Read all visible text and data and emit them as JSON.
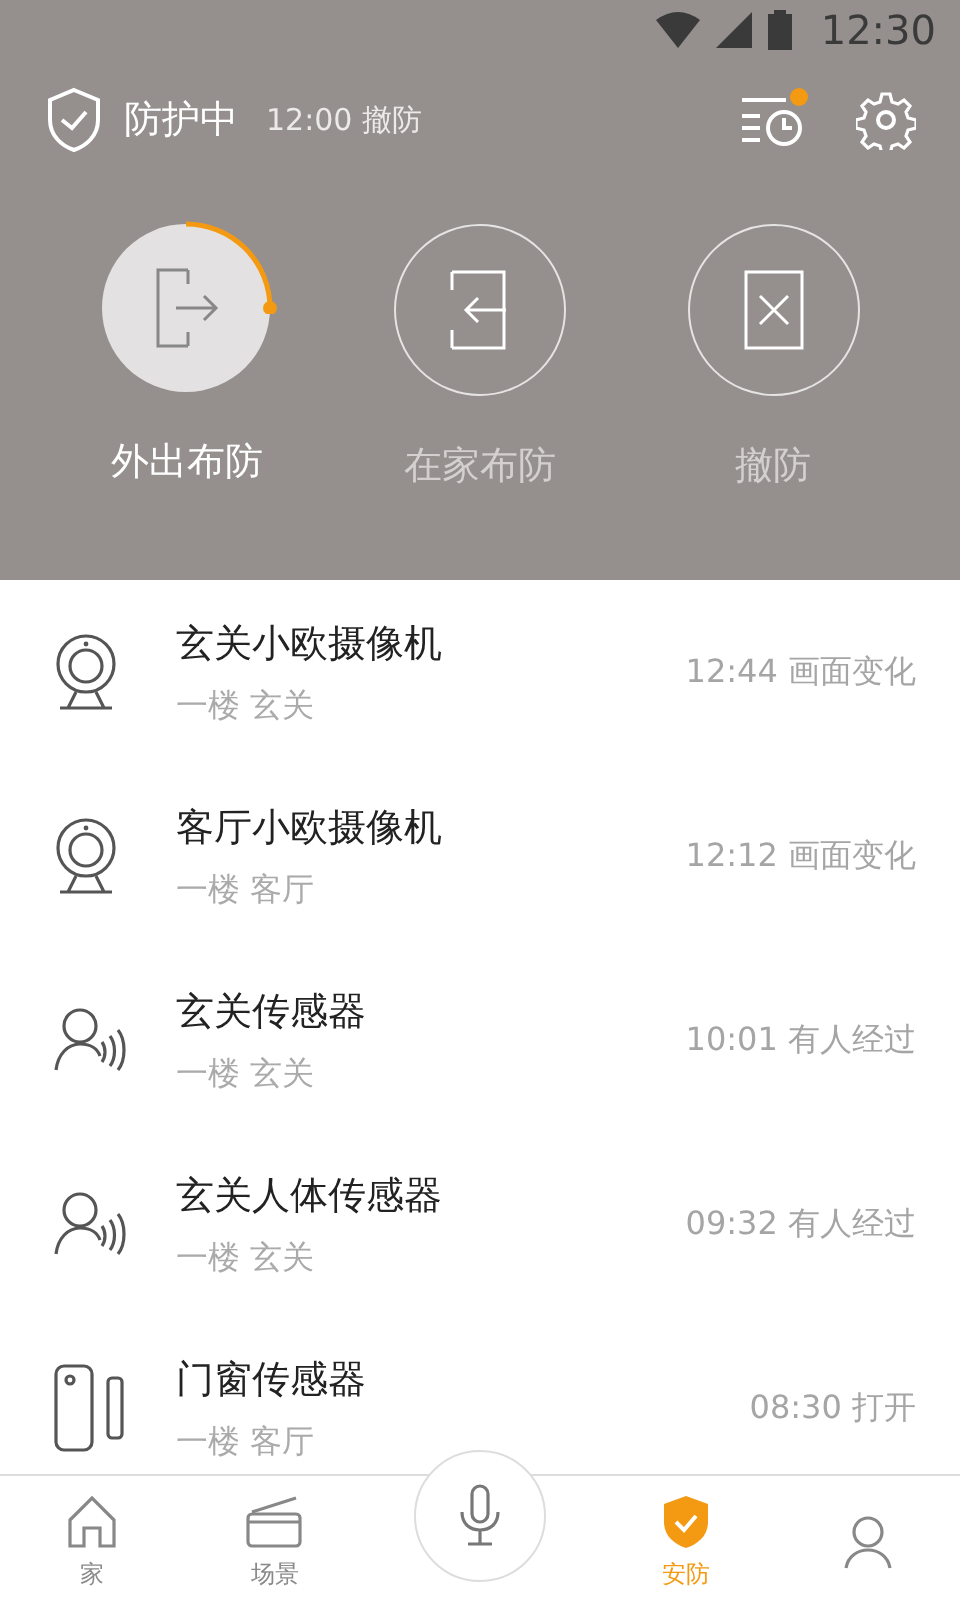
{
  "status_bar": {
    "time": "12:30"
  },
  "header": {
    "status": "防护中",
    "schedule": "12:00 撤防",
    "history_unread": true
  },
  "modes": [
    {
      "kind": "away",
      "label": "外出布防",
      "selected": true
    },
    {
      "kind": "home",
      "label": "在家布防",
      "selected": false
    },
    {
      "kind": "disarm",
      "label": "撤防",
      "selected": false
    }
  ],
  "events": [
    {
      "kind": "camera",
      "name": "玄关小欧摄像机",
      "location": "一楼 玄关",
      "event": "12:44 画面变化"
    },
    {
      "kind": "camera",
      "name": "客厅小欧摄像机",
      "location": "一楼 客厅",
      "event": "12:12 画面变化"
    },
    {
      "kind": "motion",
      "name": "玄关传感器",
      "location": "一楼 玄关",
      "event": "10:01 有人经过"
    },
    {
      "kind": "motion",
      "name": "玄关人体传感器",
      "location": "一楼 玄关",
      "event": "09:32 有人经过"
    },
    {
      "kind": "door",
      "name": "门窗传感器",
      "location": "一楼 客厅",
      "event": "08:30 打开"
    }
  ],
  "tab_bar": [
    {
      "kind": "home",
      "label": "家",
      "selected": false
    },
    {
      "kind": "scene",
      "label": "场景",
      "selected": false
    },
    {
      "kind": "mic"
    },
    {
      "kind": "shield",
      "label": "安防",
      "selected": true
    },
    {
      "kind": "person",
      "selected": false
    }
  ]
}
